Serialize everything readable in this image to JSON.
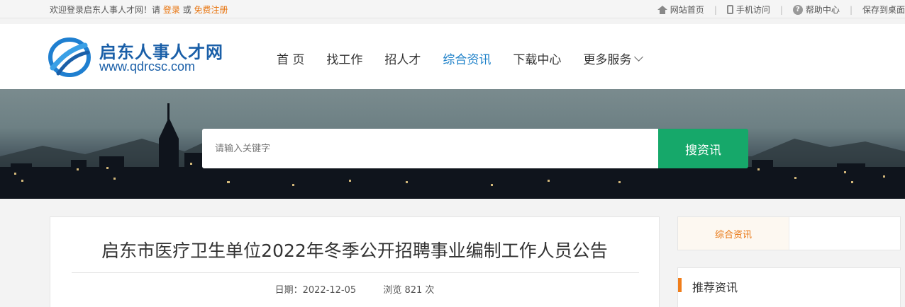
{
  "topbar": {
    "welcome_prefix": "欢迎登录启东人事人才网！请",
    "login": "登录",
    "or": "或",
    "register": "免费注册",
    "links": [
      {
        "icon": "home-icon",
        "label": "网站首页"
      },
      {
        "icon": "phone-icon",
        "label": "手机访问"
      },
      {
        "icon": "help-icon",
        "label": "帮助中心"
      },
      {
        "icon": "",
        "label": "保存到桌面"
      }
    ],
    "separator": "|"
  },
  "logo": {
    "cn": "启东人事人才网",
    "en": "www.qdrcsc.com"
  },
  "nav": {
    "items": [
      "首 页",
      "找工作",
      "招人才",
      "综合资讯",
      "下载中心"
    ],
    "active_index": 3,
    "more": "更多服务"
  },
  "search": {
    "placeholder": "请输入关键字",
    "button": "搜资讯"
  },
  "article": {
    "title": "启东市医疗卫生单位2022年冬季公开招聘事业编制工作人员公告",
    "date": "日期：2022-12-05",
    "views": "浏览 821 次"
  },
  "sidebar": {
    "tab": "综合资讯",
    "recommend": "推荐资讯"
  },
  "colors": {
    "accent_orange": "#e8730c",
    "nav_active": "#1a7fc8",
    "search_button": "#16a86a",
    "brand_blue": "#1a5fa8"
  }
}
